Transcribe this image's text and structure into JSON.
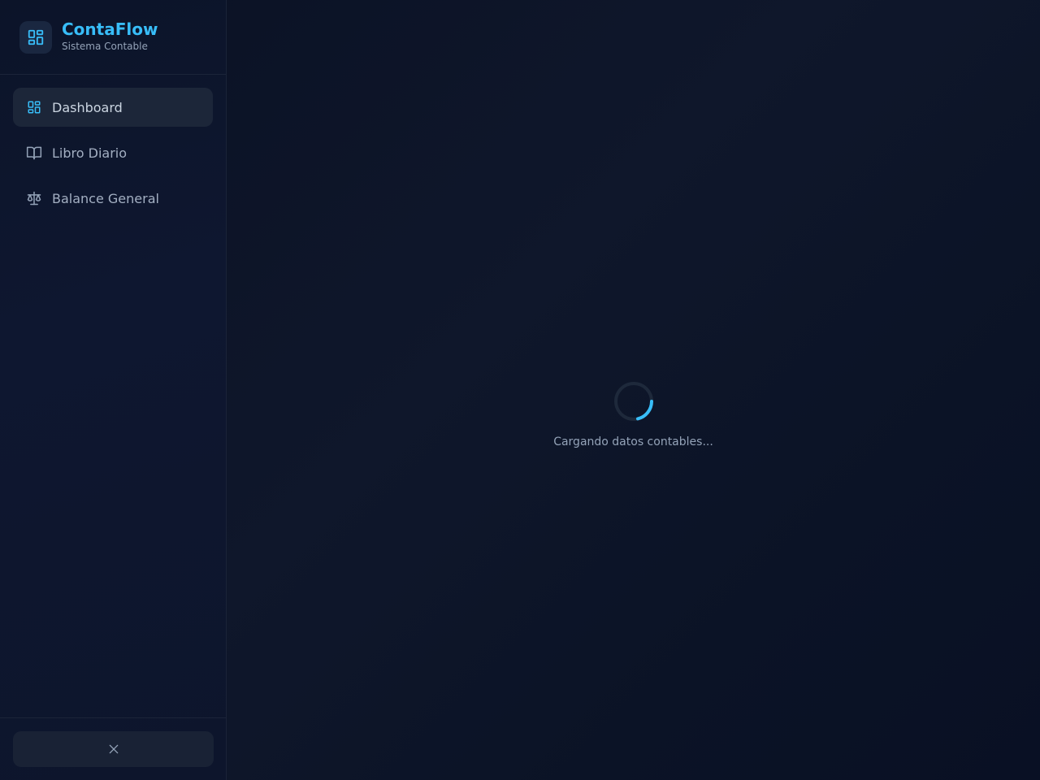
{
  "app": {
    "name": "ContaFlow",
    "subtitle": "Sistema Contable"
  },
  "sidebar": {
    "items": [
      {
        "label": "Dashboard",
        "icon": "dashboard-grid-icon",
        "active": true
      },
      {
        "label": "Libro Diario",
        "icon": "book-open-icon",
        "active": false
      },
      {
        "label": "Balance General",
        "icon": "scale-icon",
        "active": false
      }
    ],
    "footer_button_icon": "close-icon"
  },
  "main": {
    "loading_text": "Cargando datos contables...",
    "spinner_icon": "loading-spinner-icon"
  },
  "colors": {
    "accent": "#38bdf8",
    "background": "#0b1224",
    "sidebar_active": "#1c2639",
    "muted_text": "#94a3b8"
  }
}
